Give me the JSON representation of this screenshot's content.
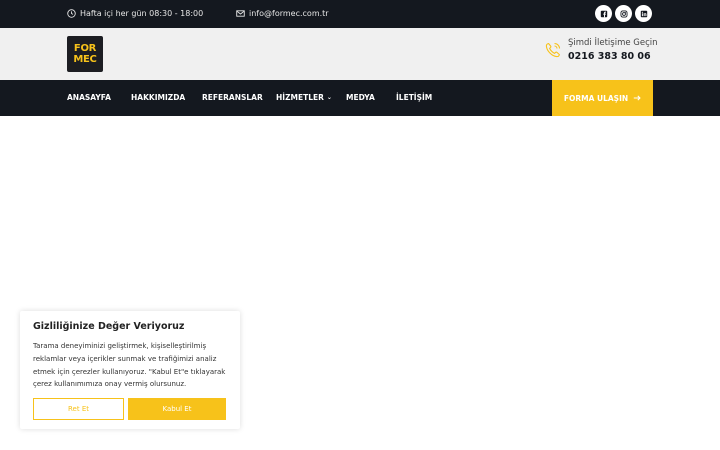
{
  "topbar": {
    "hours": "Hafta içi her gün 08:30 - 18:00",
    "email": "info@formec.com.tr",
    "social_icons": [
      "facebook-icon",
      "instagram-icon",
      "linkedin-icon"
    ]
  },
  "header": {
    "logo_line1": "FOR",
    "logo_line2": "MEC",
    "contact_label": "Şimdi İletişime Geçin",
    "contact_phone": "0216 383 80 06"
  },
  "nav": {
    "items": [
      "ANASAYFA",
      "HAKKIMIZDA",
      "REFERANSLAR",
      "HİZMETLER",
      "MEDYA",
      "İLETİŞİM"
    ],
    "cta": "FORMA ULAŞIN"
  },
  "cookie": {
    "title": "Gizliliğinize Değer Veriyoruz",
    "text": "Tarama deneyiminizi geliştirmek, kişiselleştirilmiş reklamlar veya içerikler sunmak ve trafiğimizi analiz etmek için çerezler kullanıyoruz. \"Kabul Et\"e tıklayarak çerez kullanımımıza onay vermiş olursunuz.",
    "reject": "Ret Et",
    "accept": "Kabul Et"
  },
  "colors": {
    "dark": "#14181f",
    "accent": "#f7c21a",
    "header_bg": "#f0f0f0"
  }
}
